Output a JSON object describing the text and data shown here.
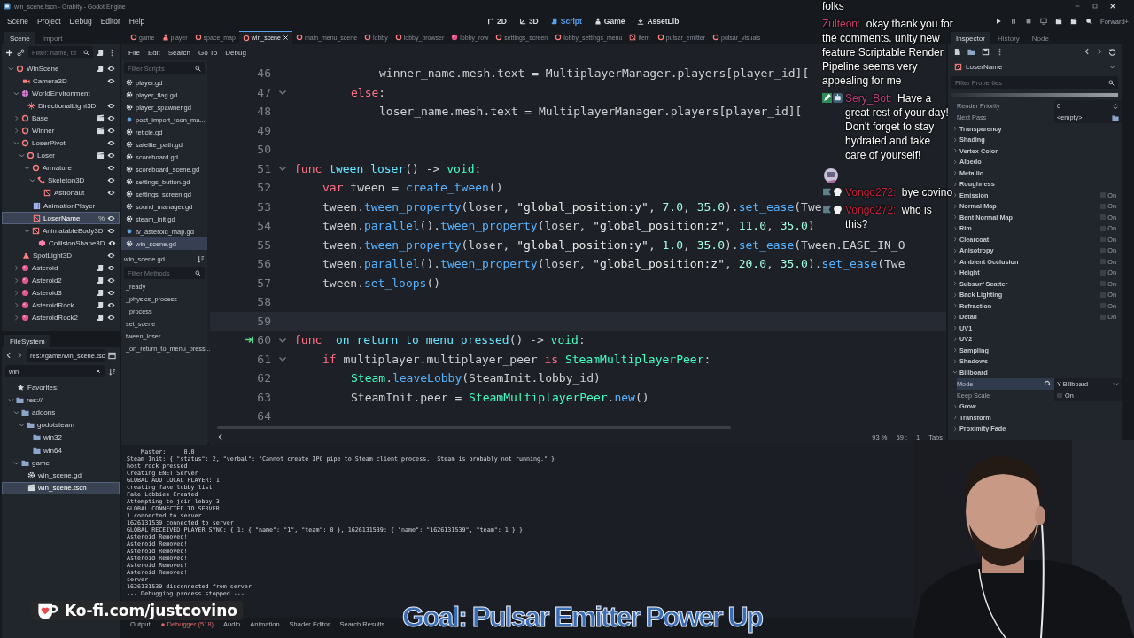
{
  "window": {
    "title": "win_scene.tscn - Grabity - Godot Engine"
  },
  "menu": [
    "Scene",
    "Project",
    "Debug",
    "Editor",
    "Help"
  ],
  "workspaces": [
    {
      "label": "2D",
      "kind": "corner",
      "selected": false
    },
    {
      "label": "3D",
      "kind": "axes",
      "selected": false
    },
    {
      "label": "Script",
      "kind": "scroll",
      "selected": true
    },
    {
      "label": "Game",
      "kind": "figure",
      "selected": false
    },
    {
      "label": "AssetLib",
      "kind": "download",
      "selected": false
    }
  ],
  "renderer": "Forward+",
  "scene_dock": {
    "tabs": [
      {
        "label": "Scene",
        "selected": true
      },
      {
        "label": "Import",
        "selected": false
      }
    ],
    "filter_placeholder": "Filter: name, t:t",
    "tree": [
      {
        "name": "WinScene",
        "kind": "ring",
        "expandable": true,
        "expanded": true,
        "script": true,
        "instance": false,
        "eye": true,
        "selected": false,
        "children": [
          {
            "name": "Camera3D",
            "kind": "camera",
            "expandable": false,
            "script": false,
            "instance": false,
            "eye": true,
            "selected": false
          },
          {
            "name": "WorldEnvironment",
            "kind": "globe",
            "expandable": true,
            "expanded": true,
            "script": false,
            "instance": false,
            "eye": false,
            "selected": false,
            "children": [
              {
                "name": "DirectionalLight3D",
                "kind": "sun",
                "expandable": false,
                "script": false,
                "instance": false,
                "eye": true,
                "selected": false
              }
            ]
          },
          {
            "name": "Base",
            "kind": "ring",
            "expandable": true,
            "expanded": false,
            "script": false,
            "instance": true,
            "eye": true,
            "selected": false
          },
          {
            "name": "Winner",
            "kind": "ring",
            "expandable": true,
            "expanded": false,
            "script": false,
            "instance": true,
            "eye": true,
            "selected": false
          },
          {
            "name": "LoserPivot",
            "kind": "ring",
            "expandable": true,
            "expanded": true,
            "script": false,
            "instance": false,
            "eye": true,
            "selected": false,
            "children": [
              {
                "name": "Loser",
                "kind": "ring",
                "expandable": true,
                "expanded": true,
                "script": false,
                "instance": true,
                "eye": true,
                "selected": false,
                "children": [
                  {
                    "name": "Armature",
                    "kind": "ring",
                    "expandable": true,
                    "expanded": true,
                    "script": false,
                    "instance": false,
                    "eye": true,
                    "selected": false,
                    "children": [
                      {
                        "name": "Skeleton3D",
                        "kind": "bone",
                        "expandable": true,
                        "expanded": true,
                        "script": false,
                        "instance": false,
                        "eye": true,
                        "selected": false,
                        "children": [
                          {
                            "name": "Astronaut",
                            "kind": "square",
                            "expandable": false,
                            "script": false,
                            "instance": false,
                            "eye": true,
                            "selected": false
                          }
                        ]
                      }
                    ]
                  },
                  {
                    "name": "AnimationPlayer",
                    "kind": "anim",
                    "expandable": false,
                    "script": false,
                    "instance": false,
                    "eye": false,
                    "selected": false
                  },
                  {
                    "name": "LoserName",
                    "kind": "square",
                    "expandable": false,
                    "script": false,
                    "instance": false,
                    "eye": true,
                    "selected": true,
                    "badge": "%"
                  },
                  {
                    "name": "AnimatableBody3D",
                    "kind": "square",
                    "expandable": true,
                    "expanded": true,
                    "script": false,
                    "instance": false,
                    "eye": true,
                    "selected": false,
                    "children": [
                      {
                        "name": "CollisionShape3D",
                        "kind": "cube",
                        "expandable": false,
                        "script": false,
                        "instance": false,
                        "eye": true,
                        "selected": false
                      }
                    ]
                  }
                ]
              }
            ]
          },
          {
            "name": "SpotLight3D",
            "kind": "lamp",
            "expandable": false,
            "script": false,
            "instance": false,
            "eye": true,
            "selected": false
          },
          {
            "name": "Asteroid",
            "kind": "ball",
            "expandable": true,
            "expanded": false,
            "script": true,
            "instance": false,
            "eye": true,
            "selected": false
          },
          {
            "name": "Asteroid2",
            "kind": "ball",
            "expandable": true,
            "expanded": false,
            "script": true,
            "instance": false,
            "eye": true,
            "selected": false
          },
          {
            "name": "Asteroid3",
            "kind": "ball",
            "expandable": true,
            "expanded": false,
            "script": true,
            "instance": false,
            "eye": true,
            "selected": false
          },
          {
            "name": "AsteroidRock",
            "kind": "ball",
            "expandable": true,
            "expanded": false,
            "script": true,
            "instance": false,
            "eye": true,
            "selected": false
          },
          {
            "name": "AsteroidRock2",
            "kind": "ball",
            "expandable": true,
            "expanded": false,
            "script": true,
            "instance": false,
            "eye": true,
            "selected": false
          }
        ]
      }
    ]
  },
  "filesystem": {
    "tabs": [
      {
        "label": "FileSystem",
        "selected": true
      }
    ],
    "path": "res://game/win_scene.tsc",
    "search": "win",
    "tree": [
      {
        "name": "Favorites:",
        "kind": "star",
        "expandable": false,
        "selected": false
      },
      {
        "name": "res://",
        "kind": "folder",
        "expandable": true,
        "expanded": true,
        "selected": false,
        "children": [
          {
            "name": "addons",
            "kind": "folder",
            "expandable": true,
            "expanded": true,
            "selected": false,
            "children": [
              {
                "name": "godotsteam",
                "kind": "folder",
                "expandable": true,
                "expanded": true,
                "selected": false,
                "children": [
                  {
                    "name": "win32",
                    "kind": "folder",
                    "expandable": false,
                    "selected": false
                  },
                  {
                    "name": "win64",
                    "kind": "folder",
                    "expandable": false,
                    "selected": false
                  }
                ]
              }
            ]
          },
          {
            "name": "game",
            "kind": "folder",
            "expandable": true,
            "expanded": true,
            "selected": false,
            "children": [
              {
                "name": "win_scene.gd",
                "kind": "gear",
                "expandable": false,
                "selected": false
              },
              {
                "name": "win_scene.tscn",
                "kind": "clapper",
                "expandable": false,
                "selected": true
              }
            ]
          }
        ]
      }
    ]
  },
  "script_tabs": [
    {
      "label": "game",
      "kind": "ring",
      "selected": false
    },
    {
      "label": "player",
      "kind": "figure",
      "selected": false
    },
    {
      "label": "space_map",
      "kind": "ring",
      "selected": false
    },
    {
      "label": "win_scene",
      "kind": "ring",
      "selected": true
    },
    {
      "label": "main_menu_scene",
      "kind": "ring",
      "selected": false
    },
    {
      "label": "lobby",
      "kind": "ring",
      "selected": false
    },
    {
      "label": "lobby_browser",
      "kind": "ring",
      "selected": false
    },
    {
      "label": "lobby_row",
      "kind": "ball",
      "selected": false
    },
    {
      "label": "settings_screen",
      "kind": "ring",
      "selected": false
    },
    {
      "label": "lobby_settings_menu",
      "kind": "ring",
      "selected": false
    },
    {
      "label": "item",
      "kind": "square",
      "selected": false
    },
    {
      "label": "pulsar_emitter",
      "kind": "ring",
      "selected": false
    },
    {
      "label": "pulsar_visuals",
      "kind": "ring",
      "selected": false
    }
  ],
  "script_menu": [
    "File",
    "Edit",
    "Search",
    "Go To",
    "Debug"
  ],
  "script_panel": {
    "filter_placeholder": "Filter Scripts",
    "scripts": [
      {
        "name": "player.gd",
        "kind": "gear",
        "selected": false
      },
      {
        "name": "player_flag.gd",
        "kind": "gear",
        "selected": false
      },
      {
        "name": "player_spawner.gd",
        "kind": "gear",
        "selected": false
      },
      {
        "name": "post_import_toon_ma...",
        "kind": "dot",
        "selected": false
      },
      {
        "name": "reticle.gd",
        "kind": "gear",
        "selected": false
      },
      {
        "name": "satelite_path.gd",
        "kind": "gear",
        "selected": false
      },
      {
        "name": "scoreboard.gd",
        "kind": "gear",
        "selected": false
      },
      {
        "name": "scoreboard_scene.gd",
        "kind": "gear",
        "selected": false
      },
      {
        "name": "settings_button.gd",
        "kind": "gear",
        "selected": false
      },
      {
        "name": "settings_screen.gd",
        "kind": "gear",
        "selected": false
      },
      {
        "name": "sound_manager.gd",
        "kind": "gear",
        "selected": false
      },
      {
        "name": "steam_init.gd",
        "kind": "gear",
        "selected": false
      },
      {
        "name": "tv_asteroid_map.gd",
        "kind": "dot",
        "selected": false
      },
      {
        "name": "win_scene.gd",
        "kind": "gear",
        "selected": true
      }
    ],
    "current": "win_scene.gd",
    "methods_placeholder": "Filter Methods",
    "methods": [
      "_ready",
      "_physics_process",
      "_process",
      "set_scene",
      "tween_loser",
      "_on_return_to_menu_press..."
    ]
  },
  "code": [
    {
      "n": "46",
      "fold": false,
      "signal": false,
      "current": false,
      "tokens": [
        {
          "kind": "plain",
          "text": "\t\t\twinner_name.mesh.text = MultiplayerManager.players[player_id]["
        }
      ]
    },
    {
      "n": "47",
      "fold": true,
      "signal": false,
      "current": false,
      "tokens": [
        {
          "kind": "kw",
          "text": "\t\telse"
        },
        {
          "kind": "plain",
          "text": ":"
        }
      ]
    },
    {
      "n": "48",
      "fold": false,
      "signal": false,
      "current": false,
      "tokens": [
        {
          "kind": "plain",
          "text": "\t\t\tloser_name.mesh.text = MultiplayerManager.players[player_id]["
        }
      ]
    },
    {
      "n": "49",
      "fold": false,
      "signal": false,
      "current": false
    },
    {
      "n": "50",
      "fold": false,
      "signal": false,
      "current": false
    },
    {
      "n": "51",
      "fold": true,
      "signal": false,
      "current": false,
      "tokens": [
        {
          "kind": "kw",
          "text": "func "
        },
        {
          "kind": "def",
          "text": "tween_loser"
        },
        {
          "kind": "plain",
          "text": "() -> "
        },
        {
          "kind": "type",
          "text": "void"
        },
        {
          "kind": "plain",
          "text": ":"
        }
      ]
    },
    {
      "n": "52",
      "fold": false,
      "signal": false,
      "current": false,
      "tokens": [
        {
          "kind": "kw",
          "text": "\tvar "
        },
        {
          "kind": "plain",
          "text": "tween = "
        },
        {
          "kind": "fn",
          "text": "create_tween"
        },
        {
          "kind": "plain",
          "text": "()"
        }
      ]
    },
    {
      "n": "53",
      "fold": false,
      "signal": false,
      "current": false,
      "tokens": [
        {
          "kind": "plain",
          "text": "\ttween."
        },
        {
          "kind": "fn",
          "text": "tween_property"
        },
        {
          "kind": "plain",
          "text": "(loser, "
        },
        {
          "kind": "str",
          "text": "\"global_position:y\""
        },
        {
          "kind": "plain",
          "text": ", "
        },
        {
          "kind": "num",
          "text": "7.0"
        },
        {
          "kind": "plain",
          "text": ", "
        },
        {
          "kind": "num",
          "text": "35.0"
        },
        {
          "kind": "plain",
          "text": ")."
        },
        {
          "kind": "fn",
          "text": "set_ease"
        },
        {
          "kind": "plain",
          "text": "(Twe"
        }
      ]
    },
    {
      "n": "54",
      "fold": false,
      "signal": false,
      "current": false,
      "tokens": [
        {
          "kind": "plain",
          "text": "\ttween."
        },
        {
          "kind": "fn",
          "text": "parallel"
        },
        {
          "kind": "plain",
          "text": "()."
        },
        {
          "kind": "fn",
          "text": "tween_property"
        },
        {
          "kind": "plain",
          "text": "(loser, "
        },
        {
          "kind": "str",
          "text": "\"global_position:z\""
        },
        {
          "kind": "plain",
          "text": ", "
        },
        {
          "kind": "num",
          "text": "11.0"
        },
        {
          "kind": "plain",
          "text": ", "
        },
        {
          "kind": "num",
          "text": "35.0"
        },
        {
          "kind": "plain",
          "text": ")"
        }
      ]
    },
    {
      "n": "55",
      "fold": false,
      "signal": false,
      "current": false,
      "tokens": [
        {
          "kind": "plain",
          "text": "\ttween."
        },
        {
          "kind": "fn",
          "text": "tween_property"
        },
        {
          "kind": "plain",
          "text": "(loser, "
        },
        {
          "kind": "str",
          "text": "\"global_position:y\""
        },
        {
          "kind": "plain",
          "text": ", "
        },
        {
          "kind": "num",
          "text": "1.0"
        },
        {
          "kind": "plain",
          "text": ", "
        },
        {
          "kind": "num",
          "text": "35.0"
        },
        {
          "kind": "plain",
          "text": ")."
        },
        {
          "kind": "fn",
          "text": "set_ease"
        },
        {
          "kind": "plain",
          "text": "(Tween.EASE_IN_O"
        }
      ]
    },
    {
      "n": "56",
      "fold": false,
      "signal": false,
      "current": false,
      "tokens": [
        {
          "kind": "plain",
          "text": "\ttween."
        },
        {
          "kind": "fn",
          "text": "parallel"
        },
        {
          "kind": "plain",
          "text": "()."
        },
        {
          "kind": "fn",
          "text": "tween_property"
        },
        {
          "kind": "plain",
          "text": "(loser, "
        },
        {
          "kind": "str",
          "text": "\"global_position:z\""
        },
        {
          "kind": "plain",
          "text": ", "
        },
        {
          "kind": "num",
          "text": "20.0"
        },
        {
          "kind": "plain",
          "text": ", "
        },
        {
          "kind": "num",
          "text": "35.0"
        },
        {
          "kind": "plain",
          "text": ")."
        },
        {
          "kind": "fn",
          "text": "set_ease"
        },
        {
          "kind": "plain",
          "text": "(Twe"
        }
      ]
    },
    {
      "n": "57",
      "fold": false,
      "signal": false,
      "current": false,
      "tokens": [
        {
          "kind": "plain",
          "text": "\ttween."
        },
        {
          "kind": "fn",
          "text": "set_loops"
        },
        {
          "kind": "plain",
          "text": "()"
        }
      ]
    },
    {
      "n": "58",
      "fold": false,
      "signal": false,
      "current": false
    },
    {
      "n": "59",
      "fold": false,
      "signal": false,
      "current": true
    },
    {
      "n": "60",
      "fold": true,
      "signal": true,
      "current": false,
      "tokens": [
        {
          "kind": "kw",
          "text": "func "
        },
        {
          "kind": "def",
          "text": "_on_return_to_menu_pressed"
        },
        {
          "kind": "plain",
          "text": "() -> "
        },
        {
          "kind": "type",
          "text": "void"
        },
        {
          "kind": "plain",
          "text": ":"
        }
      ]
    },
    {
      "n": "61",
      "fold": true,
      "signal": false,
      "current": false,
      "tokens": [
        {
          "kind": "kw",
          "text": "\tif "
        },
        {
          "kind": "plain",
          "text": "multiplayer.multiplayer_peer "
        },
        {
          "kind": "kw",
          "text": "is "
        },
        {
          "kind": "type",
          "text": "SteamMultiplayerPeer"
        },
        {
          "kind": "plain",
          "text": ":"
        }
      ]
    },
    {
      "n": "62",
      "fold": false,
      "signal": false,
      "current": false,
      "tokens": [
        {
          "kind": "type",
          "text": "\t\tSteam"
        },
        {
          "kind": "plain",
          "text": "."
        },
        {
          "kind": "fn",
          "text": "leaveLobby"
        },
        {
          "kind": "plain",
          "text": "(SteamInit.lobby_id)"
        }
      ]
    },
    {
      "n": "63",
      "fold": false,
      "signal": false,
      "current": false,
      "tokens": [
        {
          "kind": "plain",
          "text": "\t\tSteamInit.peer = "
        },
        {
          "kind": "type",
          "text": "SteamMultiplayerPeer"
        },
        {
          "kind": "plain",
          "text": "."
        },
        {
          "kind": "fn",
          "text": "new"
        },
        {
          "kind": "plain",
          "text": "()"
        }
      ]
    },
    {
      "n": "64",
      "fold": false,
      "signal": false,
      "current": false
    }
  ],
  "editor_status": {
    "zoom": "93 %",
    "line": "59 :",
    "column": "1",
    "indent": "Tabs"
  },
  "output": [
    "    Master:     0.0",
    "Steam Init: { \"status\": 2, \"verbal\": \"Cannot create IPC pipe to Steam client process.  Steam is probably not running.\" }",
    "host rock pressed",
    "Creating ENET Server",
    "GLOBAL ADD LOCAL PLAYER: 1",
    "creating fake lobby list",
    "Fake Lobbies Created",
    "Attempting to join lobby 3",
    "GLOBAL CONNECTED TO SERVER",
    "1 connected to server",
    "1626131539 connected to server",
    "GLOBAL RECEIVED PLAYER SYNC: { 1: { \"name\": \"1\", \"team\": 0 }, 1626131539: { \"name\": \"1626131539\", \"team\": 1 } }",
    "Asteroid Removed!",
    "Asteroid Removed!",
    "Asteroid Removed!",
    "Asteroid Removed!",
    "Asteroid Removed!",
    "Asteroid Removed!",
    "server",
    "1626131539 disconnected from server",
    "--- Debugging process stopped ---"
  ],
  "bottom_tabs": [
    {
      "label": "Output",
      "selected": false,
      "alert": false
    },
    {
      "label": "Debugger (518)",
      "selected": false,
      "alert": true
    },
    {
      "label": "Audio",
      "selected": false,
      "alert": false
    },
    {
      "label": "Animation",
      "selected": false,
      "alert": false
    },
    {
      "label": "Shader Editor",
      "selected": false,
      "alert": false
    },
    {
      "label": "Search Results",
      "selected": false,
      "alert": false
    }
  ],
  "inspector": {
    "tabs": [
      {
        "label": "Inspector",
        "selected": true
      },
      {
        "label": "History",
        "selected": false
      },
      {
        "label": "Node",
        "selected": false
      }
    ],
    "object": "LoserName",
    "filter_placeholder": "Filter Properties",
    "properties": [
      {
        "kind": "number",
        "label": "Render Priority",
        "value": "0"
      },
      {
        "kind": "resource",
        "label": "Next Pass",
        "value": "<empty>"
      }
    ],
    "sections": [
      {
        "label": "Transparency",
        "expanded": false
      },
      {
        "label": "Shading",
        "expanded": false
      },
      {
        "label": "Vertex Color",
        "expanded": false
      },
      {
        "label": "Albedo",
        "expanded": false
      },
      {
        "label": "Metallic",
        "expanded": false
      },
      {
        "label": "Roughness",
        "expanded": false
      },
      {
        "label": "Emission",
        "expanded": false,
        "toggle": {
          "label": "On",
          "checked": false
        }
      },
      {
        "label": "Normal Map",
        "expanded": false,
        "toggle": {
          "label": "On",
          "checked": false
        }
      },
      {
        "label": "Bent Normal Map",
        "expanded": false,
        "toggle": {
          "label": "On",
          "checked": false
        }
      },
      {
        "label": "Rim",
        "expanded": false,
        "toggle": {
          "label": "On",
          "checked": false
        }
      },
      {
        "label": "Clearcoat",
        "expanded": false,
        "toggle": {
          "label": "On",
          "checked": false
        }
      },
      {
        "label": "Anisotropy",
        "expanded": false,
        "toggle": {
          "label": "On",
          "checked": false
        }
      },
      {
        "label": "Ambient Occlusion",
        "expanded": false,
        "toggle": {
          "label": "On",
          "checked": false
        }
      },
      {
        "label": "Height",
        "expanded": false,
        "toggle": {
          "label": "On",
          "checked": false
        }
      },
      {
        "label": "Subsurf Scatter",
        "expanded": false,
        "toggle": {
          "label": "On",
          "checked": false
        }
      },
      {
        "label": "Back Lighting",
        "expanded": false,
        "toggle": {
          "label": "On",
          "checked": false
        }
      },
      {
        "label": "Refraction",
        "expanded": false,
        "toggle": {
          "label": "On",
          "checked": false
        }
      },
      {
        "label": "Detail",
        "expanded": false,
        "toggle": {
          "label": "On",
          "checked": false
        }
      },
      {
        "label": "UV1",
        "expanded": false
      },
      {
        "label": "UV2",
        "expanded": false
      },
      {
        "label": "Sampling",
        "expanded": false
      },
      {
        "label": "Shadows",
        "expanded": false
      },
      {
        "label": "Billboard",
        "expanded": true,
        "properties": [
          {
            "kind": "enum",
            "label": "Mode",
            "value": "Y-Billboard",
            "selected": true
          },
          {
            "kind": "check",
            "label": "Keep Scale",
            "value": "On",
            "checked": false,
            "selected": false
          }
        ]
      },
      {
        "label": "Grow",
        "expanded": false
      },
      {
        "label": "Transform",
        "expanded": false
      },
      {
        "label": "Proximity Fade",
        "expanded": false
      }
    ]
  },
  "chat": [
    {
      "kind": "continuation",
      "text": "folks"
    },
    {
      "kind": "message",
      "user": "Zulteon:",
      "color": "#c8416f",
      "text": "okay thank you for the comments. unity new feature Scriptable Render Pipeline seems very appealing for me"
    },
    {
      "kind": "message",
      "user": "Sery_Bot:",
      "color": "#b9437c",
      "badges": [
        {
          "kind": "pen"
        },
        {
          "kind": "robot"
        }
      ],
      "text": "Have a great rest of your day! Don't forget to stay hydrated and take care of yourself!"
    },
    {
      "kind": "emote"
    },
    {
      "kind": "message",
      "user": "Vongo272:",
      "color": "#c2243f",
      "badges": [
        {
          "kind": "flag"
        },
        {
          "kind": "skull"
        }
      ],
      "text": "bye covino"
    },
    {
      "kind": "message",
      "user": "Vongo272:",
      "color": "#c2243f",
      "badges": [
        {
          "kind": "flag"
        },
        {
          "kind": "skull"
        }
      ],
      "text": "who is this?"
    }
  ],
  "overlay": {
    "kofi": "Ko-fi.com/justcovino",
    "goal": "Goal: Pulsar Emitter Power Up"
  }
}
